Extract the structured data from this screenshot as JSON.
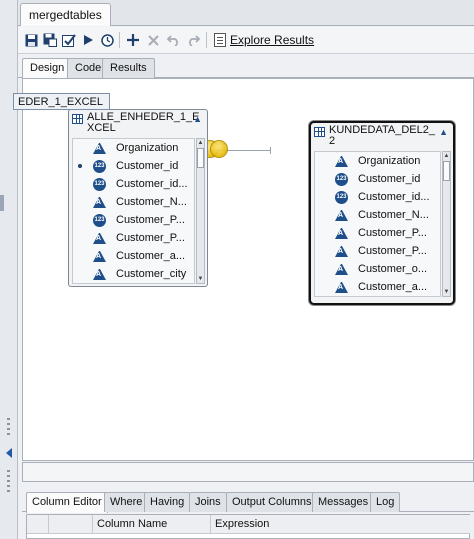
{
  "document_tab": "mergedtables",
  "toolbar": {
    "explore_label": "Explore Results"
  },
  "design_tabs": [
    {
      "label": "Design",
      "active": true
    },
    {
      "label": "Code",
      "active": false
    },
    {
      "label": "Results",
      "active": false
    }
  ],
  "canvas_label": "EDER_1_EXCEL",
  "table1": {
    "title_line1": "ALLE_ENHEDER_1_E",
    "title_line2": "XCEL",
    "columns": [
      {
        "name": "Organization",
        "type": "char",
        "selected": false
      },
      {
        "name": "Customer_id",
        "type": "num",
        "selected": true
      },
      {
        "name": "Customer_id...",
        "type": "num",
        "selected": false
      },
      {
        "name": "Customer_N...",
        "type": "char",
        "selected": false
      },
      {
        "name": "Customer_P...",
        "type": "num",
        "selected": false
      },
      {
        "name": "Customer_P...",
        "type": "char",
        "selected": false
      },
      {
        "name": "Customer_a...",
        "type": "char",
        "selected": false
      },
      {
        "name": "Customer_city",
        "type": "char",
        "selected": false
      }
    ]
  },
  "table2": {
    "title_line1": "KUNDEDATA_DEL2_",
    "title_line2": "2",
    "columns": [
      {
        "name": "Organization",
        "type": "char",
        "selected": false
      },
      {
        "name": "Customer_id",
        "type": "num",
        "selected": false
      },
      {
        "name": "Customer_id...",
        "type": "num",
        "selected": false
      },
      {
        "name": "Customer_N...",
        "type": "char",
        "selected": false
      },
      {
        "name": "Customer_P...",
        "type": "char",
        "selected": false
      },
      {
        "name": "Customer_P...",
        "type": "char",
        "selected": false
      },
      {
        "name": "Customer_o...",
        "type": "char",
        "selected": false
      },
      {
        "name": "Customer_a...",
        "type": "char",
        "selected": false
      }
    ]
  },
  "bottom_tabs": [
    {
      "label": "Column Editor",
      "active": true
    },
    {
      "label": "Where",
      "active": false
    },
    {
      "label": "Having",
      "active": false
    },
    {
      "label": "Joins",
      "active": false
    },
    {
      "label": "Output Columns",
      "active": false
    },
    {
      "label": "Messages",
      "active": false
    },
    {
      "label": "Log",
      "active": false
    }
  ],
  "column_table_headers": {
    "column_name": "Column Name",
    "expression": "Expression"
  },
  "colors": {
    "icon_blue": "#1f4f8a",
    "join_yellow": "#e4b800"
  }
}
